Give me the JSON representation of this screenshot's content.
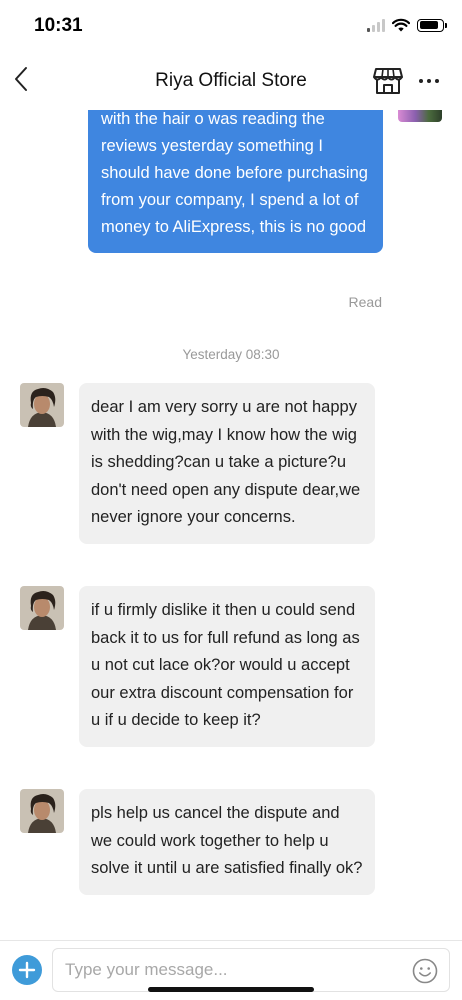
{
  "status_bar": {
    "time": "10:31",
    "signal_bars_active": 1,
    "battery_level": 0.85
  },
  "header": {
    "title": "Riya Official Store"
  },
  "icons": {
    "back": "chevron-left-icon",
    "store": "store-icon",
    "more": "more-horizontal-icon",
    "add": "plus-icon",
    "emoji": "smiley-icon"
  },
  "chat": {
    "outgoing": {
      "text": "with the hair o was reading the reviews yesterday something I should have done before purchasing from your company, I spend a lot of money to AliExpress, this is no good",
      "status": "Read"
    },
    "timestamp": "Yesterday 08:30",
    "incoming": [
      {
        "text": "dear I am very sorry u are not happy with the wig,may I know how the wig is shedding?can u take a picture?u don't need open any dispute dear,we never ignore your concerns."
      },
      {
        "text": "if u firmly dislike it then u could send back it to us for full refund as long as u not cut lace ok?or would u accept our extra discount compensation for u if u decide to keep it?"
      },
      {
        "text": "pls help us cancel the dispute and we could work together to help u solve it until u are satisfied finally ok?"
      }
    ]
  },
  "input": {
    "placeholder": "Type your message...",
    "value": ""
  },
  "colors": {
    "outgoing_bubble": "#3f86e0",
    "incoming_bubble": "#f0f0f0",
    "accent_add": "#3f9bd9"
  }
}
